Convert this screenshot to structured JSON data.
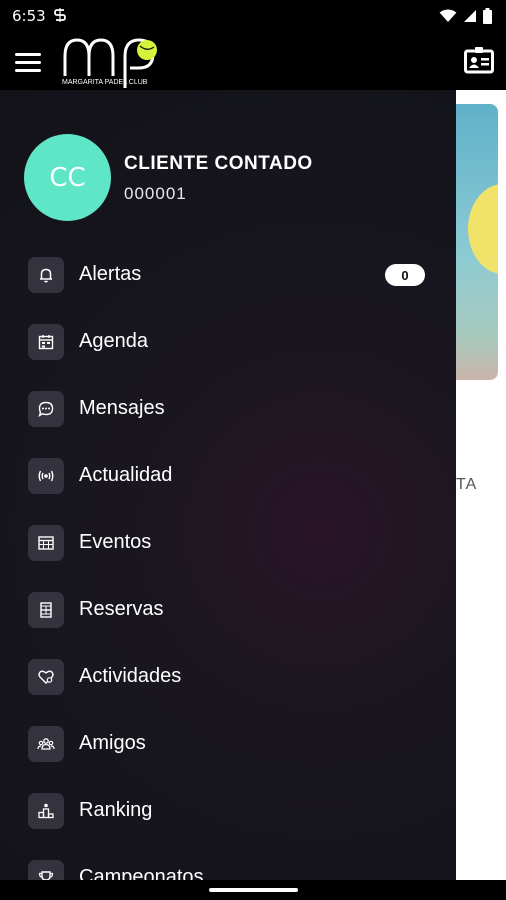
{
  "status_bar": {
    "time": "6:53",
    "notification_icon": "s-icon"
  },
  "app_bar": {
    "logo_text": "MARGARITA PADEL CLUB"
  },
  "background": {
    "partial_text": "TA"
  },
  "profile": {
    "initials": "CC",
    "name": "CLIENTE CONTADO",
    "id": "000001",
    "avatar_color": "#5ee6c7"
  },
  "menu": {
    "items": [
      {
        "label": "Alertas",
        "icon": "bell-icon",
        "badge": "0"
      },
      {
        "label": "Agenda",
        "icon": "calendar-icon"
      },
      {
        "label": "Mensajes",
        "icon": "chat-icon"
      },
      {
        "label": "Actualidad",
        "icon": "broadcast-icon"
      },
      {
        "label": "Eventos",
        "icon": "grid-calendar-icon"
      },
      {
        "label": "Reservas",
        "icon": "court-icon"
      },
      {
        "label": "Actividades",
        "icon": "heart-icon"
      },
      {
        "label": "Amigos",
        "icon": "group-icon"
      },
      {
        "label": "Ranking",
        "icon": "podium-icon"
      },
      {
        "label": "Campeonatos",
        "icon": "trophy-icon"
      }
    ]
  }
}
